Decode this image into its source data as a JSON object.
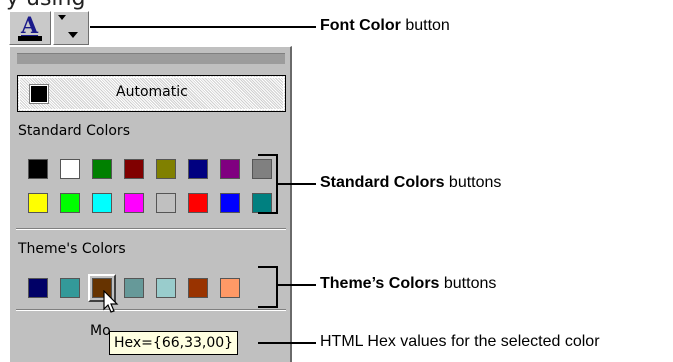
{
  "top_fragment": "y using",
  "toolbar": {
    "font_color_icon": "A"
  },
  "panel": {
    "automatic_label": "Automatic",
    "standard_heading": "Standard Colors",
    "theme_heading": "Theme's Colors",
    "more_label": "Mo",
    "standard_colors": [
      [
        "#000000",
        "#ffffff",
        "#008000",
        "#800000",
        "#808000",
        "#000080",
        "#800080",
        "#808080"
      ],
      [
        "#ffff00",
        "#00ff00",
        "#00ffff",
        "#ff00ff",
        "#c0c0c0",
        "#ff0000",
        "#0000ff",
        "#008080"
      ]
    ],
    "theme_colors": [
      "#000066",
      "#339999",
      "#663300",
      "#669999",
      "#99cccc",
      "#993300",
      "#ff9966"
    ],
    "selected_theme_index": 2,
    "tooltip": "Hex={66,33,00}"
  },
  "callouts": {
    "font_color_bold": "Font Color",
    "font_color_rest": " button",
    "standard_bold": "Standard Colors",
    "standard_rest": " buttons",
    "theme_bold": "Theme’s Colors",
    "theme_rest": " buttons",
    "hex_text": "HTML Hex values for the selected color"
  }
}
